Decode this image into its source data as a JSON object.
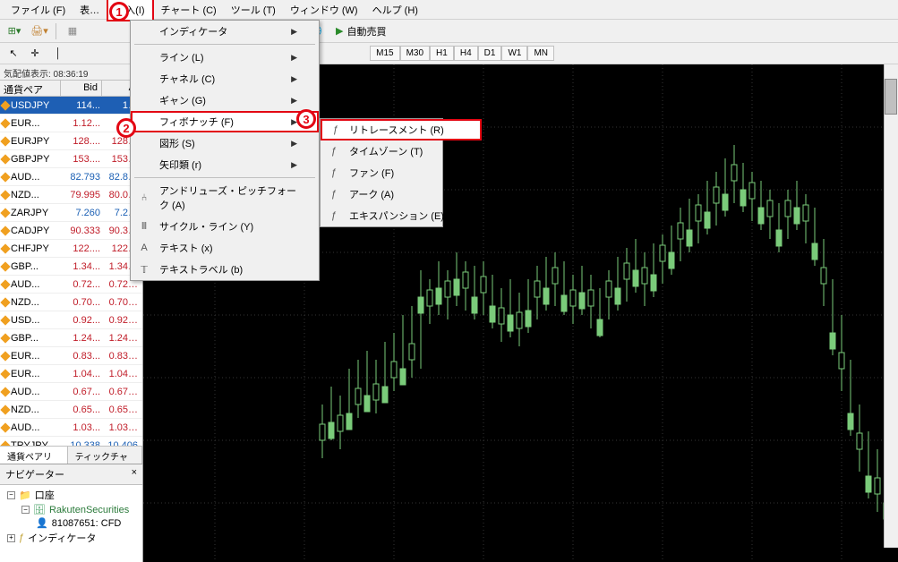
{
  "menubar": {
    "items": [
      "ファイル (F)",
      "表…",
      "挿入(I)",
      "チャート (C)",
      "ツール (T)",
      "ウィンドウ (W)",
      "ヘルプ (H)"
    ]
  },
  "toolbar": {
    "autoTrade": "自動売買"
  },
  "timeframes": [
    "M15",
    "M30",
    "H1",
    "H4",
    "D1",
    "W1",
    "MN"
  ],
  "marketWatch": {
    "tickerLabel": "気配値表示: 08:36:19",
    "headers": {
      "symbol": "通貨ペア",
      "bid": "Bid",
      "ask": "A"
    },
    "rows": [
      {
        "sym": "USDJPY",
        "bid": "114...",
        "ask": "1…",
        "dir": "up",
        "sel": true
      },
      {
        "sym": "EUR...",
        "bid": "1.12...",
        "ask": "1…",
        "dir": "down"
      },
      {
        "sym": "EURJPY",
        "bid": "128....",
        "ask": "128…",
        "dir": "down"
      },
      {
        "sym": "GBPJPY",
        "bid": "153....",
        "ask": "153…",
        "dir": "down"
      },
      {
        "sym": "AUD...",
        "bid": "82.793",
        "ask": "82.8…",
        "dir": "up"
      },
      {
        "sym": "NZD...",
        "bid": "79.995",
        "ask": "80.0…",
        "dir": "down"
      },
      {
        "sym": "ZARJPY",
        "bid": "7.260",
        "ask": "7.2…",
        "dir": "up"
      },
      {
        "sym": "CADJPY",
        "bid": "90.333",
        "ask": "90.3…",
        "dir": "down"
      },
      {
        "sym": "CHFJPY",
        "bid": "122....",
        "ask": "122…",
        "dir": "down"
      },
      {
        "sym": "GBP...",
        "bid": "1.34...",
        "ask": "1.34…",
        "dir": "down"
      },
      {
        "sym": "AUD...",
        "bid": "0.72...",
        "ask": "0.72…",
        "dir": "down"
      },
      {
        "sym": "NZD...",
        "bid": "0.70...",
        "ask": "0.70…",
        "dir": "down"
      },
      {
        "sym": "USD...",
        "bid": "0.92...",
        "ask": "0.92…",
        "dir": "down"
      },
      {
        "sym": "GBP...",
        "bid": "1.24...",
        "ask": "1.24…",
        "dir": "down"
      },
      {
        "sym": "EUR...",
        "bid": "0.83...",
        "ask": "0.83…",
        "dir": "down"
      },
      {
        "sym": "EUR...",
        "bid": "1.04...",
        "ask": "1.04…",
        "dir": "down"
      },
      {
        "sym": "AUD...",
        "bid": "0.67...",
        "ask": "0.67…",
        "dir": "down"
      },
      {
        "sym": "NZD...",
        "bid": "0.65...",
        "ask": "0.65…",
        "dir": "down"
      },
      {
        "sym": "AUD...",
        "bid": "1.03...",
        "ask": "1.03…",
        "dir": "down"
      },
      {
        "sym": "TRYJPY",
        "bid": "10.338",
        "ask": "10.406",
        "dir": "up"
      }
    ],
    "tabs": {
      "list": "通貨ペアリスト",
      "tick": "ティックチャート"
    }
  },
  "navigator": {
    "title": "ナビゲーター",
    "close": "×",
    "account": "口座",
    "rakuten": "RakutenSecurities",
    "accNum": "81087651: CFD",
    "indicators": "インディケータ"
  },
  "insertMenu": {
    "items": [
      {
        "label": "インディケータ",
        "arrow": true
      },
      {
        "sep": true
      },
      {
        "label": "ライン (L)",
        "arrow": true
      },
      {
        "label": "チャネル (C)",
        "arrow": true
      },
      {
        "label": "ギャン (G)",
        "arrow": true
      },
      {
        "label": "フィボナッチ (F)",
        "arrow": true,
        "hl": true
      },
      {
        "label": "図形 (S)",
        "arrow": true
      },
      {
        "label": "矢印類 (r)",
        "arrow": true
      },
      {
        "sep": true
      },
      {
        "label": "アンドリューズ・ピッチフォーク (A)",
        "icon": "⑃"
      },
      {
        "label": "サイクル・ライン (Y)",
        "icon": "𝍫"
      },
      {
        "label": "テキスト (x)",
        "icon": "A"
      },
      {
        "label": "テキストラベル (b)",
        "icon": "𝕋"
      }
    ]
  },
  "fiboSubmenu": {
    "items": [
      {
        "label": "リトレースメント (R)",
        "icon": "ƒ",
        "hl": true
      },
      {
        "label": "タイムゾーン (T)",
        "icon": "ƒ"
      },
      {
        "label": "ファン (F)",
        "icon": "ƒ"
      },
      {
        "label": "アーク (A)",
        "icon": "ƒ"
      },
      {
        "label": "エキスパンション (E)",
        "icon": "ƒ"
      }
    ]
  },
  "badges": {
    "b1": "1",
    "b2": "2",
    "b3": "3"
  }
}
